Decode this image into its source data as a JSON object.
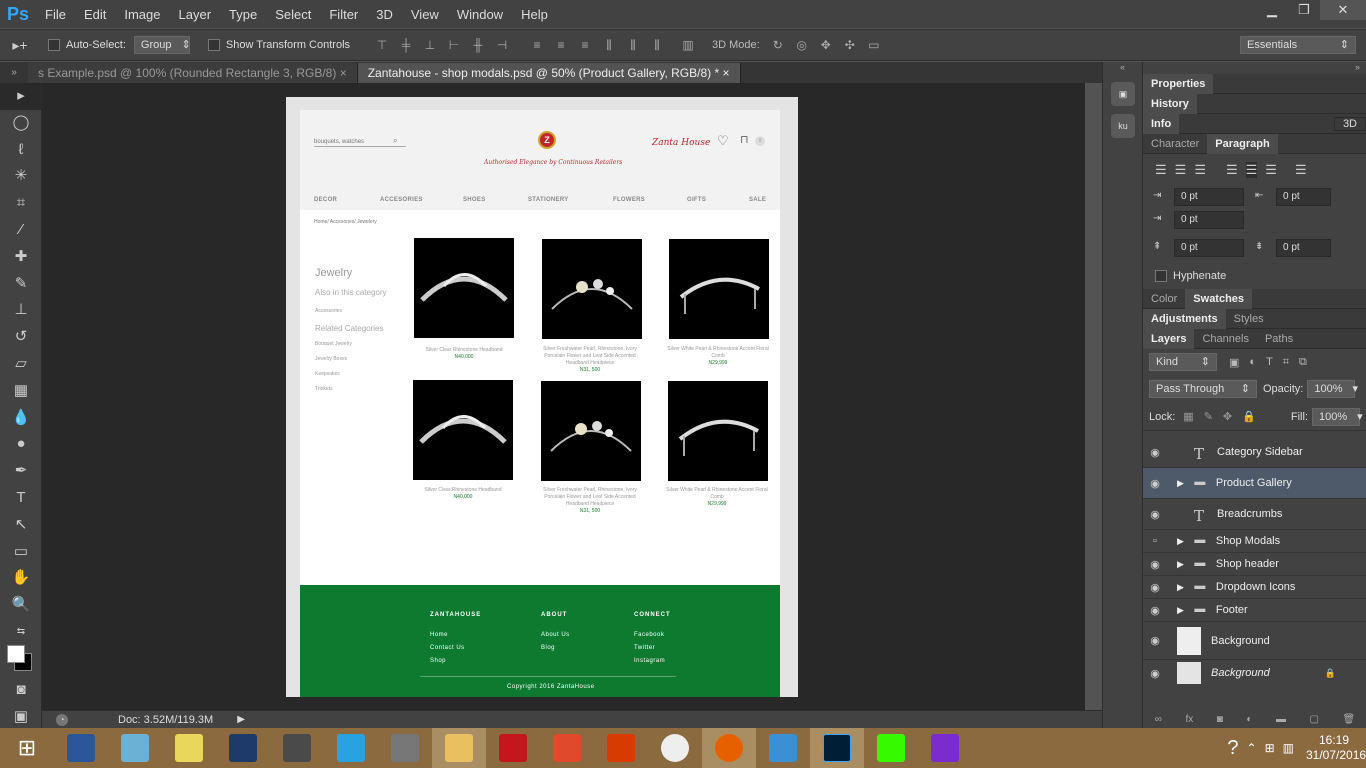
{
  "app": {
    "name": "Ps",
    "menus": [
      "File",
      "Edit",
      "Image",
      "Layer",
      "Type",
      "Select",
      "Filter",
      "3D",
      "View",
      "Window",
      "Help"
    ]
  },
  "options": {
    "auto_select": "Auto-Select:",
    "group": "Group",
    "show_transform": "Show Transform Controls",
    "mode_3d": "3D Mode:",
    "workspace": "Essentials"
  },
  "tabs": [
    {
      "label": "s Example.psd @ 100% (Rounded Rectangle 3, RGB/8)"
    },
    {
      "label": "Zantahouse - shop modals.psd @ 50% (Product Gallery, RGB/8) *"
    }
  ],
  "status": {
    "doc": "Doc: 3.52M/119.3M"
  },
  "design": {
    "search": "bouquets, watches",
    "logo": "Z",
    "tagline": "Authorised Elegance by Continuous Retailers",
    "user": "Zanta House",
    "nav": [
      "DECOR",
      "ACCESORIES",
      "SHOES",
      "STATIONERY",
      "FLOWERS",
      "GIFTS",
      "SALE"
    ],
    "breadcrumb": "Home/ Accesories/ Jewelery",
    "sidebar": {
      "title": "Jewelry",
      "also": "Also in this category",
      "also_item": "Accessories",
      "related": "Related Categories",
      "items": [
        "Bouquet Jewelry",
        "Jewelry Boxes",
        "Keepsakes",
        "Trinkets"
      ]
    },
    "products": [
      {
        "name": "Silver Clear Rhinestone Headband",
        "price": "N40,000"
      },
      {
        "name": "Silver Freshwater Pearl, Rhinestone, Ivory Porcelain Flower and Leaf Side Accented Headband Headpiece",
        "price": "N31, 500"
      },
      {
        "name": "Silver White Pearl & Rhinestone Accent Floral Comb",
        "price": "N29,999"
      },
      {
        "name": "Silver Clear Rhinestone Headband",
        "price": "N40,000"
      },
      {
        "name": "Silver Freshwater Pearl, Rhinestone, Ivory Porcelain Flower and Leaf Side Accented Headband Headpiece",
        "price": "N31, 500"
      },
      {
        "name": "Silver White Pearl & Rhinestone Accent Floral Comb",
        "price": "N29,999"
      }
    ],
    "footer": {
      "col1": {
        "head": "ZANTAHOUSE",
        "links": [
          "Home",
          "Contact Us",
          "Shop"
        ]
      },
      "col2": {
        "head": "ABOUT",
        "links": [
          "About Us",
          "Blog"
        ]
      },
      "col3": {
        "head": "CONNECT",
        "links": [
          "Facebook",
          "Twitter",
          "Instagram"
        ]
      },
      "copyright": "Copyright 2016 ZantaHouse"
    }
  },
  "panels": {
    "properties": "Properties",
    "history": "History",
    "info": "Info",
    "three_d": "3D",
    "character": "Character",
    "paragraph": "Paragraph",
    "pt": [
      "0 pt",
      "0 pt",
      "0 pt",
      "0 pt",
      "0 pt"
    ],
    "hyphenate": "Hyphenate",
    "color": "Color",
    "swatches": "Swatches",
    "adjustments": "Adjustments",
    "styles": "Styles",
    "layers": "Layers",
    "channels": "Channels",
    "paths": "Paths",
    "kind": "Kind",
    "blend": "Pass Through",
    "opacity_label": "Opacity:",
    "opacity": "100%",
    "lock": "Lock:",
    "fill_label": "Fill:",
    "fill": "100%",
    "layer_list": [
      "Category Sidebar",
      "Product Gallery",
      "Breadcrumbs",
      "Shop Modals",
      "Shop header",
      "Dropdown Icons",
      "Footer",
      "Background",
      "Background"
    ]
  },
  "clock": {
    "time": "16:19",
    "date": "31/07/2016"
  }
}
